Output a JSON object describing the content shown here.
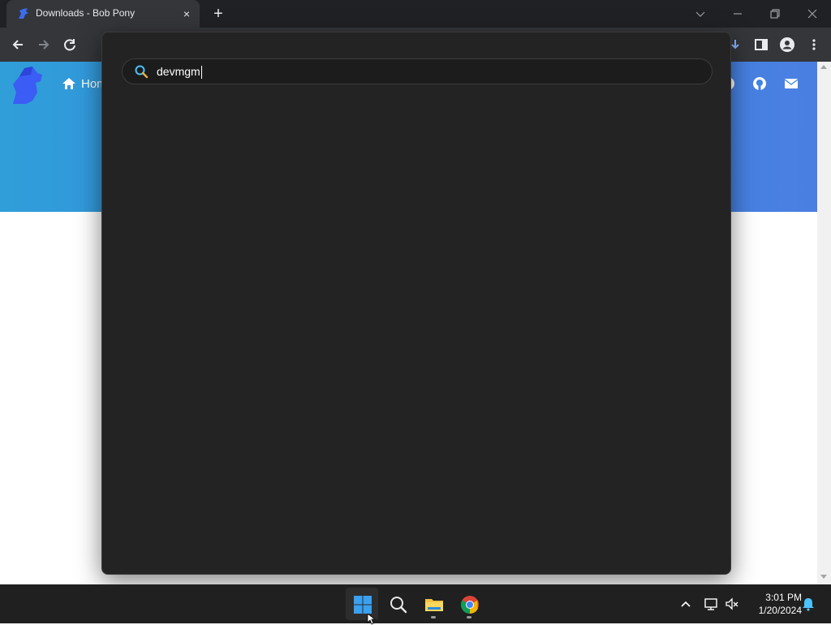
{
  "browser": {
    "tab_title": "Downloads - Bob Pony",
    "tab_close_glyph": "×",
    "new_tab_glyph": "+",
    "icons": [
      "pony-favicon-icon",
      "back-arrow-icon",
      "forward-arrow-icon",
      "reload-icon",
      "download-icon",
      "side-panel-icon",
      "profile-icon",
      "menu-dots-icon",
      "minimize-icon",
      "restore-icon",
      "close-icon",
      "tab-search-icon"
    ]
  },
  "page": {
    "nav_home_label": "Hom",
    "accent": "#3e86e0"
  },
  "search": {
    "query": "devmgm",
    "icon": "search-icon"
  },
  "taskbar": {
    "apps": [
      "windows-start-icon",
      "search-icon",
      "file-explorer-icon",
      "chrome-icon"
    ],
    "time": "3:01 PM",
    "date": "1/20/2024",
    "tray_icons": [
      "chevron-up-icon",
      "network-icon",
      "volume-muted-icon",
      "notification-bell-icon"
    ]
  }
}
